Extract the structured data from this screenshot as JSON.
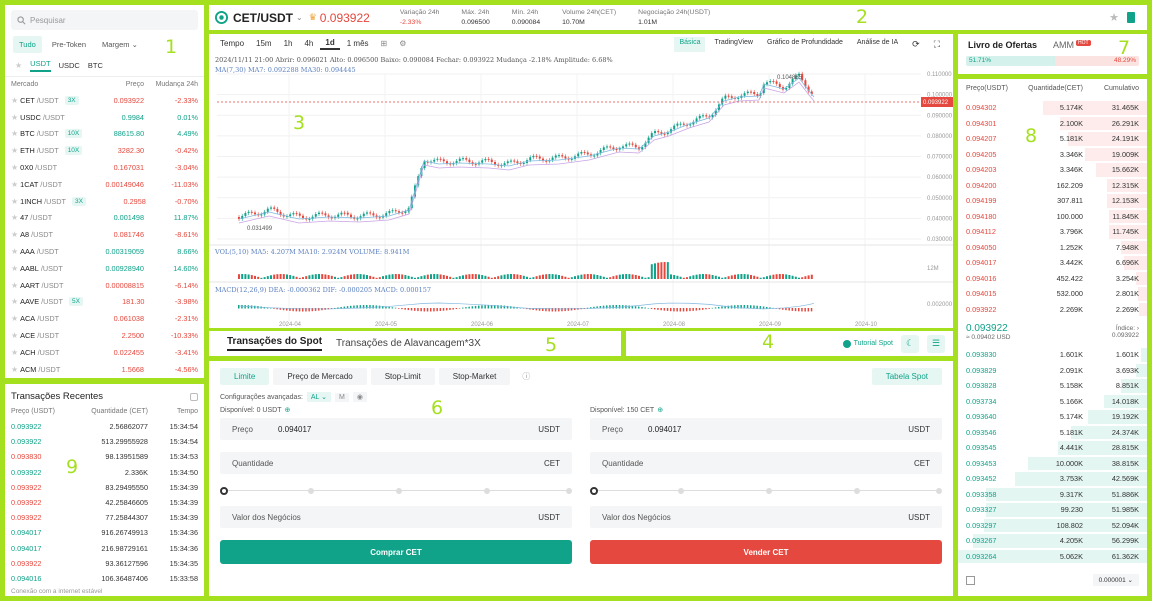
{
  "zones": [
    "1",
    "2",
    "3",
    "4",
    "5",
    "6",
    "7",
    "8",
    "9"
  ],
  "markets": {
    "search_placeholder": "Pesquisar",
    "tabs": [
      "Tudo",
      "Pre-Token",
      "Margem"
    ],
    "quotes": [
      "USDT",
      "USDC",
      "BTC"
    ],
    "head": {
      "market": "Mercado",
      "price": "Preço",
      "change": "Mudança 24h"
    },
    "rows": [
      {
        "base": "CET",
        "quote": "/USDT",
        "lev": "3X",
        "price": "0.093922",
        "change": "-2.33%",
        "up": false
      },
      {
        "base": "USDC",
        "quote": "/USDT",
        "lev": "",
        "price": "0.9984",
        "change": "0.01%",
        "up": true
      },
      {
        "base": "BTC",
        "quote": "/USDT",
        "lev": "10X",
        "price": "88615.80",
        "change": "4.49%",
        "up": true
      },
      {
        "base": "ETH",
        "quote": "/USDT",
        "lev": "10X",
        "price": "3282.30",
        "change": "-0.42%",
        "up": false
      },
      {
        "base": "0X0",
        "quote": "/USDT",
        "lev": "",
        "price": "0.167031",
        "change": "-3.04%",
        "up": false
      },
      {
        "base": "1CAT",
        "quote": "/USDT",
        "lev": "",
        "price": "0.00149046",
        "change": "-11.03%",
        "up": false
      },
      {
        "base": "1INCH",
        "quote": "/USDT",
        "lev": "3X",
        "price": "0.2958",
        "change": "-0.70%",
        "up": false
      },
      {
        "base": "47",
        "quote": "/USDT",
        "lev": "",
        "price": "0.001498",
        "change": "11.87%",
        "up": true
      },
      {
        "base": "A8",
        "quote": "/USDT",
        "lev": "",
        "price": "0.081746",
        "change": "-8.61%",
        "up": false
      },
      {
        "base": "AAA",
        "quote": "/USDT",
        "lev": "",
        "price": "0.00319059",
        "change": "8.66%",
        "up": true
      },
      {
        "base": "AABL",
        "quote": "/USDT",
        "lev": "",
        "price": "0.00928940",
        "change": "14.60%",
        "up": true
      },
      {
        "base": "AART",
        "quote": "/USDT",
        "lev": "",
        "price": "0.00008815",
        "change": "-6.14%",
        "up": false
      },
      {
        "base": "AAVE",
        "quote": "/USDT",
        "lev": "5X",
        "price": "181.30",
        "change": "-3.98%",
        "up": false
      },
      {
        "base": "ACA",
        "quote": "/USDT",
        "lev": "",
        "price": "0.061038",
        "change": "-2.31%",
        "up": false
      },
      {
        "base": "ACE",
        "quote": "/USDT",
        "lev": "",
        "price": "2.2500",
        "change": "-10.33%",
        "up": false
      },
      {
        "base": "ACH",
        "quote": "/USDT",
        "lev": "",
        "price": "0.022455",
        "change": "-3.41%",
        "up": false
      },
      {
        "base": "ACM",
        "quote": "/USDT",
        "lev": "",
        "price": "1.5668",
        "change": "-4.56%",
        "up": false
      }
    ]
  },
  "recent": {
    "title": "Transações Recentes",
    "head": {
      "price": "Preço (USDT)",
      "qty": "Quantidade (CET)",
      "time": "Tempo"
    },
    "rows": [
      {
        "p": "0.093922",
        "q": "2.56862077",
        "t": "15:34:54",
        "up": true
      },
      {
        "p": "0.093922",
        "q": "513.29955928",
        "t": "15:34:54",
        "up": true
      },
      {
        "p": "0.093830",
        "q": "98.13951589",
        "t": "15:34:53",
        "up": false
      },
      {
        "p": "0.093922",
        "q": "2.336K",
        "t": "15:34:50",
        "up": true
      },
      {
        "p": "0.093922",
        "q": "83.29495550",
        "t": "15:34:39",
        "up": false
      },
      {
        "p": "0.093922",
        "q": "42.25846605",
        "t": "15:34:39",
        "up": false
      },
      {
        "p": "0.093922",
        "q": "77.25844307",
        "t": "15:34:39",
        "up": false
      },
      {
        "p": "0.094017",
        "q": "916.26749913",
        "t": "15:34:36",
        "up": true
      },
      {
        "p": "0.094017",
        "q": "216.98729161",
        "t": "15:34:36",
        "up": true
      },
      {
        "p": "0.093922",
        "q": "93.36127596",
        "t": "15:34:35",
        "up": false
      },
      {
        "p": "0.094016",
        "q": "106.36487406",
        "t": "15:33:58",
        "up": true
      }
    ],
    "footer": "Conexão com a internet estável"
  },
  "header": {
    "pair": "CET/USDT",
    "price": "0.093922",
    "stats": [
      {
        "l": "Variação 24h",
        "v": "-2.33%",
        "red": true
      },
      {
        "l": "Máx. 24h",
        "v": "0.096500",
        "red": false
      },
      {
        "l": "Mín. 24h",
        "v": "0.090084",
        "red": false
      },
      {
        "l": "Volume 24h(CET)",
        "v": "10.70M",
        "red": false
      },
      {
        "l": "Negociação 24h(USDT)",
        "v": "1.01M",
        "red": false
      }
    ]
  },
  "chart": {
    "intervals": [
      "Tempo",
      "15m",
      "1h",
      "4h",
      "1d",
      "1 mês"
    ],
    "modes": [
      "Básica",
      "TradingView",
      "Gráfico de Profundidade",
      "Análise de IA"
    ],
    "info1": "2024/11/11 21:00  Abrir: 0.096021  Alto: 0.096500  Baixo: 0.090084  Fechar: 0.093922  Mudança -2.18%  Amplitude: 6.68%",
    "ma": "MA(7,30)  MA7: 0.092288  MA30: 0.094445",
    "vol": "VOL(5,10)  MA5: 4.207M  MA10: 2.924M  VOLUME: 8.941M",
    "macd": "MACD(12,26,9)  DEA: -0.000362  DIF: -0.000205  MACD: 0.000157",
    "high_label": "0.104885",
    "low_label": "0.031499",
    "last_label": "0.093922",
    "yticks": [
      "0.110000",
      "0.100000",
      "0.090000",
      "0.080000",
      "0.070000",
      "0.060000",
      "0.050000",
      "0.040000",
      "0.030000"
    ],
    "xticks": [
      "2024-04",
      "2024-05",
      "2024-06",
      "2024-07",
      "2024-08",
      "2024-09",
      "2024-10"
    ],
    "vol_tick": "12M",
    "macd_tick": "0.002000"
  },
  "trade_tabs": [
    "Transações do Spot",
    "Transações de Alavancagem*3X"
  ],
  "toolbar4": {
    "tutorial": "Tutorial Spot"
  },
  "order": {
    "types": [
      "Limite",
      "Preço de Mercado",
      "Stop-Limit",
      "Stop-Market"
    ],
    "table": "Tabela Spot",
    "adv": "Configurações avançadas:",
    "adv_val": "AL",
    "buy": {
      "avail": "Disponível: 0 USDT",
      "price_l": "Preço",
      "price": "0.094017",
      "unit": "USDT",
      "qty_l": "Quantidade",
      "qty_unit": "CET",
      "total_l": "Valor dos Negócios",
      "total_unit": "USDT",
      "btn": "Comprar CET"
    },
    "sell": {
      "avail": "Disponível: 150 CET",
      "price_l": "Preço",
      "price": "0.094017",
      "unit": "USDT",
      "qty_l": "Quantidade",
      "qty_unit": "CET",
      "total_l": "Valor dos Negócios",
      "total_unit": "USDT",
      "btn": "Vender CET"
    }
  },
  "book": {
    "title": "Livro de Ofertas",
    "amm": "AMM",
    "hot": "HOT",
    "buy_pct": "51.71%",
    "sell_pct": "48.29%",
    "head": {
      "p": "Preço(USDT)",
      "q": "Quantidade(CET)",
      "c": "Cumulativo"
    },
    "asks": [
      {
        "p": "0.094302",
        "q": "5.174K",
        "c": "31.465K",
        "d": 0.55
      },
      {
        "p": "0.094301",
        "q": "2.100K",
        "c": "26.291K",
        "d": 0.46
      },
      {
        "p": "0.094207",
        "q": "5.181K",
        "c": "24.191K",
        "d": 0.42
      },
      {
        "p": "0.094205",
        "q": "3.346K",
        "c": "19.009K",
        "d": 0.33
      },
      {
        "p": "0.094203",
        "q": "3.346K",
        "c": "15.662K",
        "d": 0.27
      },
      {
        "p": "0.094200",
        "q": "162.209",
        "c": "12.315K",
        "d": 0.21
      },
      {
        "p": "0.094199",
        "q": "307.811",
        "c": "12.153K",
        "d": 0.21
      },
      {
        "p": "0.094180",
        "q": "100.000",
        "c": "11.845K",
        "d": 0.2
      },
      {
        "p": "0.094112",
        "q": "3.796K",
        "c": "11.745K",
        "d": 0.2
      },
      {
        "p": "0.094050",
        "q": "1.252K",
        "c": "7.948K",
        "d": 0.14
      },
      {
        "p": "0.094017",
        "q": "3.442K",
        "c": "6.696K",
        "d": 0.12
      },
      {
        "p": "0.094016",
        "q": "452.422",
        "c": "3.254K",
        "d": 0.06
      },
      {
        "p": "0.094015",
        "q": "532.000",
        "c": "2.801K",
        "d": 0.05
      },
      {
        "p": "0.093922",
        "q": "2.269K",
        "c": "2.269K",
        "d": 0.04
      }
    ],
    "mid": "0.093922",
    "mid_sub": "≈ 0.09402 USD",
    "index_l": "Índice:",
    "index_v": "0.093922",
    "bids": [
      {
        "p": "0.093830",
        "q": "1.601K",
        "c": "1.601K",
        "d": 0.03
      },
      {
        "p": "0.093829",
        "q": "2.091K",
        "c": "3.693K",
        "d": 0.06
      },
      {
        "p": "0.093828",
        "q": "5.158K",
        "c": "8.851K",
        "d": 0.14
      },
      {
        "p": "0.093734",
        "q": "5.166K",
        "c": "14.018K",
        "d": 0.23
      },
      {
        "p": "0.093640",
        "q": "5.174K",
        "c": "19.192K",
        "d": 0.31
      },
      {
        "p": "0.093546",
        "q": "5.181K",
        "c": "24.374K",
        "d": 0.4
      },
      {
        "p": "0.093545",
        "q": "4.441K",
        "c": "28.815K",
        "d": 0.47
      },
      {
        "p": "0.093453",
        "q": "10.000K",
        "c": "38.815K",
        "d": 0.63
      },
      {
        "p": "0.093452",
        "q": "3.753K",
        "c": "42.569K",
        "d": 0.7
      },
      {
        "p": "0.093358",
        "q": "9.317K",
        "c": "51.886K",
        "d": 0.85
      },
      {
        "p": "0.093327",
        "q": "99.230",
        "c": "51.985K",
        "d": 0.85
      },
      {
        "p": "0.093297",
        "q": "108.802",
        "c": "52.094K",
        "d": 0.86
      },
      {
        "p": "0.093267",
        "q": "4.205K",
        "c": "56.299K",
        "d": 0.92
      },
      {
        "p": "0.093264",
        "q": "5.062K",
        "c": "61.362K",
        "d": 1.0
      }
    ],
    "precision": "0.000001"
  }
}
